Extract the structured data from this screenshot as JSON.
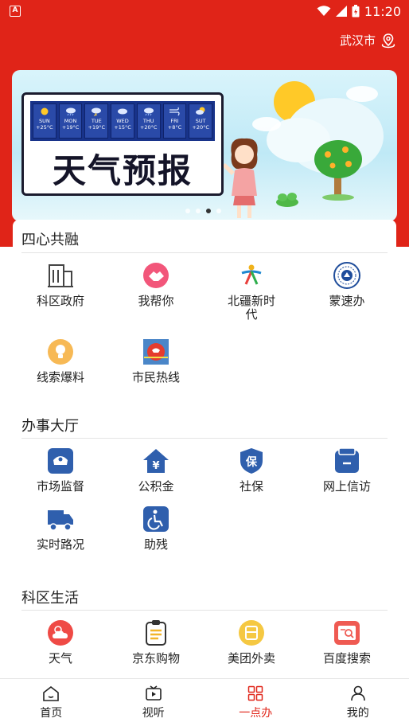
{
  "status_bar": {
    "time": "11:20"
  },
  "header": {
    "location": "武汉市"
  },
  "banner": {
    "title": "天气预报",
    "days": [
      "SUN",
      "MON",
      "TUE",
      "WED",
      "THU",
      "FRI",
      "SUT"
    ],
    "temps": [
      "+25°C",
      "+19°C",
      "+19°C",
      "+15°C",
      "+20°C",
      "+8°C",
      "+20°C"
    ],
    "page_count": 4,
    "active_page": 3
  },
  "sections": [
    {
      "title": "四心共融",
      "items": [
        {
          "label": "科区政府",
          "icon": "government-building-icon"
        },
        {
          "label": "我帮你",
          "icon": "handshake-icon"
        },
        {
          "label": "北疆新时代",
          "icon": "people-logo-icon"
        },
        {
          "label": "蒙速办",
          "icon": "emblem-icon"
        },
        {
          "label": "线索爆料",
          "icon": "lightbulb-icon"
        },
        {
          "label": "市民热线",
          "icon": "hotline-icon"
        }
      ]
    },
    {
      "title": "办事大厅",
      "items": [
        {
          "label": "市场监督",
          "icon": "police-cap-icon"
        },
        {
          "label": "公积金",
          "icon": "house-fund-icon"
        },
        {
          "label": "社保",
          "icon": "social-security-shield-icon"
        },
        {
          "label": "网上信访",
          "icon": "petition-box-icon"
        },
        {
          "label": "实时路况",
          "icon": "truck-icon"
        },
        {
          "label": "助残",
          "icon": "wheelchair-icon"
        }
      ]
    },
    {
      "title": "科区生活",
      "items": [
        {
          "label": "天气",
          "icon": "weather-icon"
        },
        {
          "label": "京东购物",
          "icon": "shopping-clipboard-icon"
        },
        {
          "label": "美团外卖",
          "icon": "takeout-icon"
        },
        {
          "label": "百度搜索",
          "icon": "search-card-icon"
        }
      ]
    }
  ],
  "nav": [
    {
      "label": "首页",
      "icon": "home-icon"
    },
    {
      "label": "视听",
      "icon": "video-icon"
    },
    {
      "label": "一点办",
      "icon": "grid-apps-icon"
    },
    {
      "label": "我的",
      "icon": "person-icon"
    }
  ],
  "colors": {
    "brand_red": "#e02418",
    "nav_active": "#e02418"
  }
}
